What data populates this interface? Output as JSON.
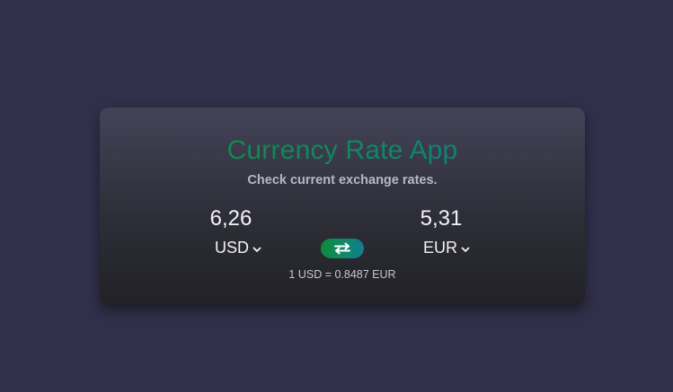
{
  "app": {
    "title": "Currency Rate App",
    "subtitle": "Check current exchange rates."
  },
  "converter": {
    "from": {
      "amount": "6,26",
      "currency": "USD"
    },
    "to": {
      "amount": "5,31",
      "currency": "EUR"
    },
    "swap_icon": "swap-arrows-icon",
    "rate_text": "1 USD = 0.8487 EUR"
  },
  "colors": {
    "background": "#31304b",
    "accent_start": "#0d8a3c",
    "accent_end": "#117c91"
  }
}
